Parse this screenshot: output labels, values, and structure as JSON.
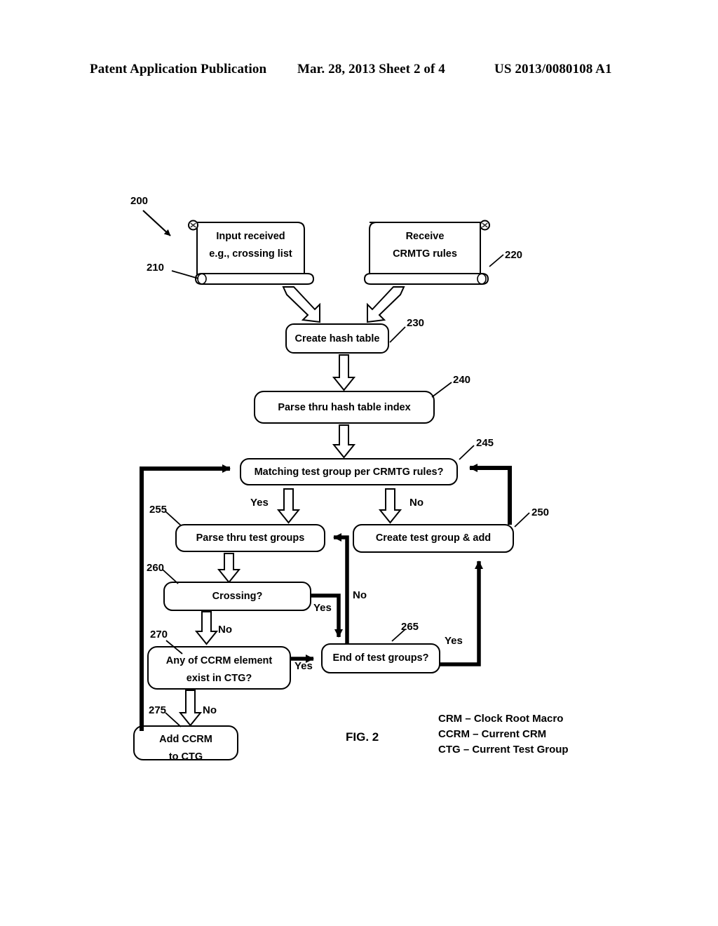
{
  "header": {
    "publication": "Patent Application Publication",
    "date_sheet": "Mar. 28, 2013  Sheet 2 of 4",
    "patent_number": "US 2013/0080108 A1"
  },
  "figure": {
    "caption": "FIG. 2",
    "diagram_ref": "200"
  },
  "nodes": [
    {
      "id": "210",
      "ref": "210",
      "shape": "document-scroll",
      "lines": [
        "Input received",
        "e.g., crossing list"
      ]
    },
    {
      "id": "220",
      "ref": "220",
      "shape": "document-scroll",
      "lines": [
        "Receive",
        "CRMTG rules"
      ]
    },
    {
      "id": "230",
      "ref": "230",
      "shape": "rounded-rect",
      "lines": [
        "Create hash table"
      ]
    },
    {
      "id": "240",
      "ref": "240",
      "shape": "rounded-rect",
      "lines": [
        "Parse thru hash table index"
      ]
    },
    {
      "id": "245",
      "ref": "245",
      "shape": "rounded-rect",
      "lines": [
        "Matching test group per CRMTG rules?"
      ]
    },
    {
      "id": "250",
      "ref": "250",
      "shape": "rounded-rect",
      "lines": [
        "Create test group & add"
      ]
    },
    {
      "id": "255",
      "ref": "255",
      "shape": "rounded-rect",
      "lines": [
        "Parse thru test groups"
      ]
    },
    {
      "id": "260",
      "ref": "260",
      "shape": "rounded-rect",
      "lines": [
        "Crossing?"
      ]
    },
    {
      "id": "265",
      "ref": "265",
      "shape": "rounded-rect",
      "lines": [
        "End of test groups?"
      ]
    },
    {
      "id": "270",
      "ref": "270",
      "shape": "rounded-rect",
      "lines": [
        "Any of CCRM element",
        "exist in CTG?"
      ]
    },
    {
      "id": "275",
      "ref": "275",
      "shape": "rounded-rect",
      "lines": [
        "Add CCRM",
        "to CTG"
      ]
    }
  ],
  "edge_labels": {
    "match_yes": "Yes",
    "match_no": "No",
    "crossing_yes": "Yes",
    "crossing_no": "No",
    "ccrm_yes": "Yes",
    "ccrm_no": "No",
    "endgroups_yes": "Yes",
    "endgroups_no": "No"
  },
  "legend": [
    "CRM – Clock Root Macro",
    "CCRM – Current CRM",
    "CTG – Current Test Group"
  ],
  "colors": {
    "ink": "#000000",
    "paper": "#ffffff"
  }
}
